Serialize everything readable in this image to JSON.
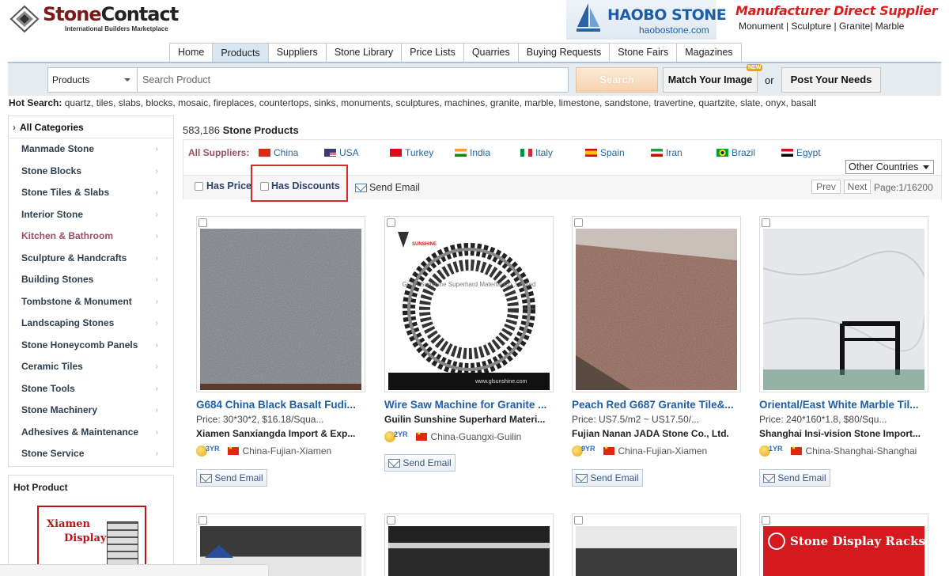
{
  "header": {
    "logo": {
      "brand1": "Stone",
      "brand2": "Contact",
      "tagline": "International Builders Marketplace"
    },
    "ad_haobo": {
      "name": "HAOBO STONE",
      "url": "haobostone.com"
    },
    "ad_mds": {
      "title": "Manufacturer Direct Supplier",
      "subtitle": "Monument | Sculpture | Granite| Marble"
    }
  },
  "nav": {
    "tabs": [
      "Home",
      "Products",
      "Suppliers",
      "Stone Library",
      "Price Lists",
      "Quarries",
      "Buying Requests",
      "Stone Fairs",
      "Magazines"
    ],
    "active": "Products"
  },
  "search": {
    "category": "Products",
    "placeholder": "Search Product",
    "search_label": "Search",
    "match_label": "Match Your Image",
    "new_badge": "NEW",
    "or_label": "or",
    "post_label": "Post Your Needs"
  },
  "hot_search": {
    "label": "Hot Search:",
    "terms": "quartz, tiles, slabs, blocks, mosaic, fireplaces, countertops, sinks, monuments, sculptures, machines, granite, marble, limestone, sandstone, travertine, quartzite, slate, onyx, basalt"
  },
  "sidebar": {
    "head": "All Categories",
    "categories": [
      "Manmade Stone",
      "Stone Blocks",
      "Stone Tiles & Slabs",
      "Interior Stone",
      "Kitchen & Bathroom",
      "Sculpture & Handcrafts",
      "Building Stones",
      "Tombstone & Monument",
      "Landscaping Stones",
      "Stone Honeycomb Panels",
      "Ceramic Tiles",
      "Stone Tools",
      "Stone Machinery",
      "Adhesives & Maintenance",
      "Stone Service"
    ],
    "highlighted": "Kitchen & Bathroom",
    "hot_product": {
      "head": "Hot Product",
      "line1": "Xiamen",
      "line2": "Displays"
    }
  },
  "results": {
    "count": "583,186",
    "count_label": "Stone Products",
    "all_suppliers": "All Suppliers:",
    "countries": [
      "China",
      "USA",
      "Turkey",
      "India",
      "Italy",
      "Spain",
      "Iran",
      "Brazil",
      "Egypt"
    ],
    "other_countries": "Other Countries",
    "has_price": "Has Price",
    "has_discounts": "Has Discounts",
    "send_email": "Send Email",
    "prev": "Prev",
    "next": "Next",
    "page_info": "Page:1/16200"
  },
  "products": [
    {
      "title": "G684 China Black Basalt Fudi...",
      "price": "Price: 30*30*2, $16.18/Squa...",
      "company": "Xiamen Sanxiangda Import & Exp...",
      "years": "3YR",
      "location": "China-Fujian-Xiamen",
      "send": "Send Email"
    },
    {
      "title": "Wire Saw Machine for Granite ...",
      "price": "",
      "company": "Guilin Sunshine Superhard Materi...",
      "years": "2YR",
      "location": "China-Guangxi-Guilin",
      "send": "Send Email",
      "img_text1": "SUNSHINE",
      "img_text2": "Guilin Sunshine Superhard Material Co.,Limited",
      "img_url": "www.glsunshine.com"
    },
    {
      "title": "Peach Red G687 Granite Tile&...",
      "price": "Price: US7.5/m2 ~ US17.50/...",
      "company": "Fujian Nanan JADA Stone Co., Ltd.",
      "years": "9YR",
      "location": "China-Fujian-Xiamen",
      "send": "Send Email"
    },
    {
      "title": "Oriental/East White Marble Til...",
      "price": "Price: 240*160*1.8, $80/Squ...",
      "company": "Shanghai Insi-vision Stone Import...",
      "years": "1YR",
      "location": "China-Shanghai-Shanghai",
      "send": "Send Email"
    }
  ],
  "row2": {
    "display_racks": "Stone Display Racks"
  },
  "colors": {
    "accent": "#1f5fa6",
    "brand_red": "#7a1a1a",
    "highlight_box": "#d32a2a",
    "category_highlight": "#9a4f5e"
  }
}
